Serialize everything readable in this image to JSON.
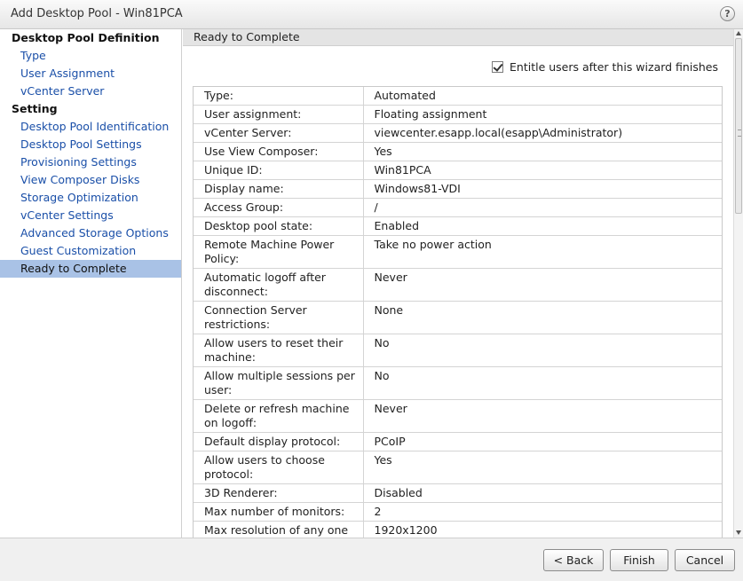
{
  "window": {
    "title": "Add Desktop Pool - Win81PCA",
    "help_glyph": "?"
  },
  "sidebar": {
    "groups": [
      {
        "label": "Desktop Pool Definition",
        "items": [
          "Type",
          "User Assignment",
          "vCenter Server"
        ]
      },
      {
        "label": "Setting",
        "items": [
          "Desktop Pool Identification",
          "Desktop Pool Settings",
          "Provisioning Settings",
          "View Composer Disks",
          "Storage Optimization",
          "vCenter Settings",
          "Advanced Storage Options",
          "Guest Customization",
          "Ready to Complete"
        ]
      }
    ],
    "active_item": "Ready to Complete"
  },
  "main": {
    "section_title": "Ready to Complete",
    "entitle_checkbox": {
      "label": "Entitle users after this wizard finishes",
      "checked": true
    },
    "rows": [
      {
        "key": "Type:",
        "value": "Automated"
      },
      {
        "key": "User assignment:",
        "value": "Floating assignment"
      },
      {
        "key": "vCenter Server:",
        "value": "viewcenter.esapp.local(esapp\\Administrator)"
      },
      {
        "key": "Use View Composer:",
        "value": "Yes"
      },
      {
        "key": "Unique ID:",
        "value": "Win81PCA"
      },
      {
        "key": "Display name:",
        "value": "Windows81-VDI"
      },
      {
        "key": "Access Group:",
        "value": "/"
      },
      {
        "key": "Desktop pool state:",
        "value": "Enabled"
      },
      {
        "key": "Remote Machine Power Policy:",
        "value": "Take no power action"
      },
      {
        "key": "Automatic logoff after disconnect:",
        "value": "Never"
      },
      {
        "key": "Connection Server restrictions:",
        "value": "None"
      },
      {
        "key": "Allow users to reset their machine:",
        "value": "No"
      },
      {
        "key": "Allow multiple sessions per user:",
        "value": "No"
      },
      {
        "key": "Delete or refresh machine on logoff:",
        "value": "Never"
      },
      {
        "key": "Default display protocol:",
        "value": "PCoIP"
      },
      {
        "key": "Allow users to choose protocol:",
        "value": "Yes"
      },
      {
        "key": "3D Renderer:",
        "value": "Disabled"
      },
      {
        "key": "Max number of monitors:",
        "value": "2"
      },
      {
        "key": "Max resolution of any one",
        "value": "1920x1200"
      }
    ]
  },
  "footer": {
    "back_label": "< Back",
    "finish_label": "Finish",
    "cancel_label": "Cancel"
  }
}
